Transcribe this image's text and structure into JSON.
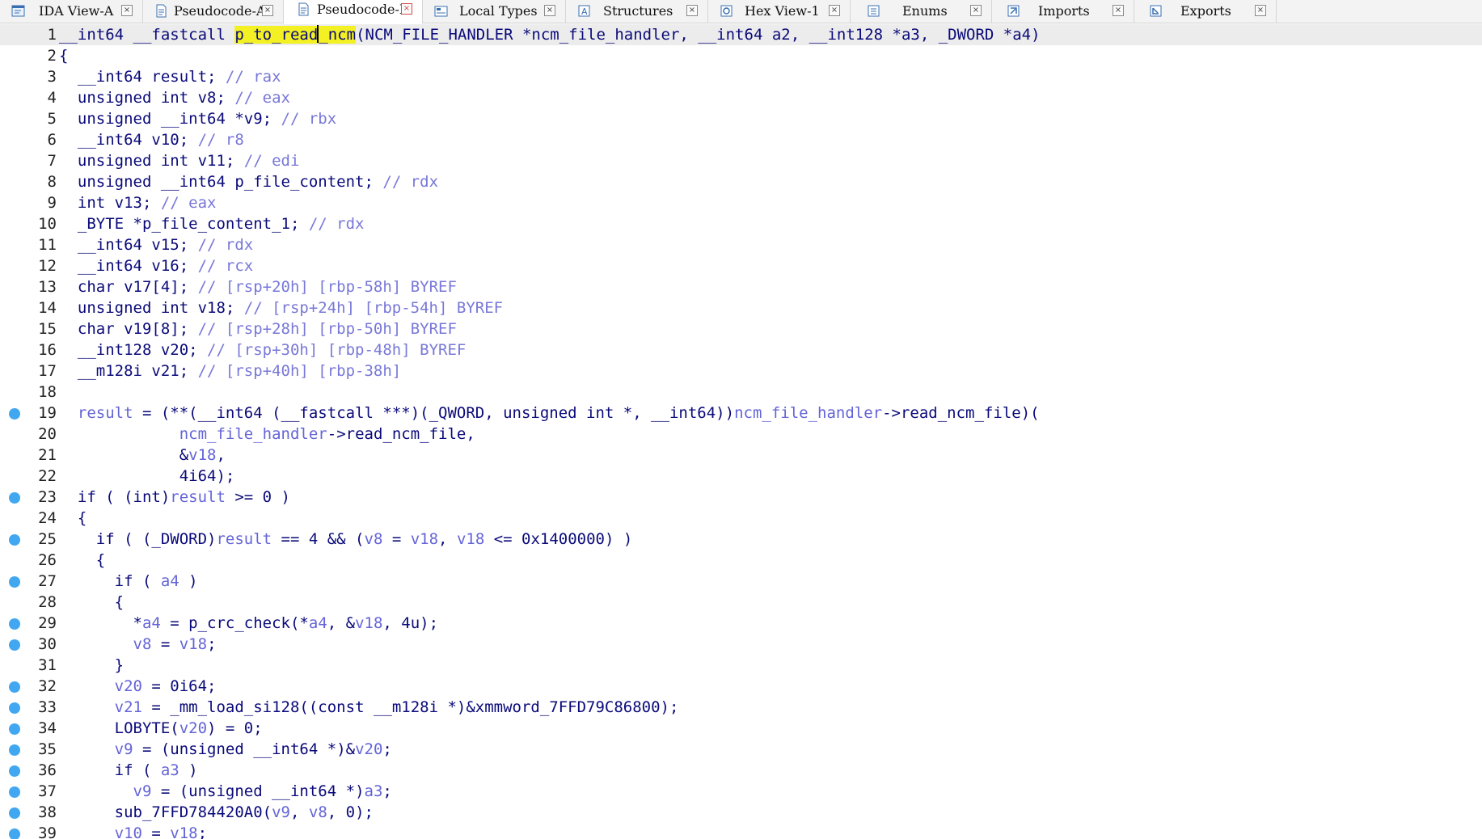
{
  "colors": {
    "keyword": "#0a0a7a",
    "variable": "#6464d8",
    "comment": "#7878d8",
    "highlight": "#f3f023",
    "breakpoint_dot": "#41a7f0",
    "current_line_bg": "#ececec"
  },
  "tabs": [
    {
      "label": "IDA View-A",
      "icon": "ida-view-icon",
      "active": false
    },
    {
      "label": "Pseudocode-A",
      "icon": "pseudocode-icon",
      "active": false
    },
    {
      "label": "Pseudocode-B",
      "icon": "pseudocode-icon",
      "active": true
    },
    {
      "label": "Local Types",
      "icon": "local-types-icon",
      "active": false
    },
    {
      "label": "Structures",
      "icon": "structures-icon",
      "active": false
    },
    {
      "label": "Hex View-1",
      "icon": "hex-view-icon",
      "active": false
    },
    {
      "label": "Enums",
      "icon": "enums-icon",
      "active": false
    },
    {
      "label": "Imports",
      "icon": "imports-icon",
      "active": false
    },
    {
      "label": "Exports",
      "icon": "exports-icon",
      "active": false
    }
  ],
  "close_glyph": "×",
  "code": {
    "highlighted_identifier": "p_to_read_ncm",
    "lines": [
      {
        "n": "1",
        "dot": false,
        "tokens": [
          [
            "k",
            "__int64 __fastcall "
          ],
          [
            "h",
            "p_to_read"
          ],
          [
            "caret",
            ""
          ],
          [
            "h",
            "_ncm"
          ],
          [
            "k",
            "(NCM_FILE_HANDLER *ncm_file_handler, __int64 a2, __int128 *a3, _DWORD *a4)"
          ]
        ]
      },
      {
        "n": "2",
        "dot": false,
        "tokens": [
          [
            "k",
            "{"
          ]
        ]
      },
      {
        "n": "3",
        "dot": false,
        "tokens": [
          [
            "k",
            "  __int64 result; "
          ],
          [
            "c",
            "// rax"
          ]
        ]
      },
      {
        "n": "4",
        "dot": false,
        "tokens": [
          [
            "k",
            "  unsigned int v8; "
          ],
          [
            "c",
            "// eax"
          ]
        ]
      },
      {
        "n": "5",
        "dot": false,
        "tokens": [
          [
            "k",
            "  unsigned __int64 *v9; "
          ],
          [
            "c",
            "// rbx"
          ]
        ]
      },
      {
        "n": "6",
        "dot": false,
        "tokens": [
          [
            "k",
            "  __int64 v10; "
          ],
          [
            "c",
            "// r8"
          ]
        ]
      },
      {
        "n": "7",
        "dot": false,
        "tokens": [
          [
            "k",
            "  unsigned int v11; "
          ],
          [
            "c",
            "// edi"
          ]
        ]
      },
      {
        "n": "8",
        "dot": false,
        "tokens": [
          [
            "k",
            "  unsigned __int64 p_file_content; "
          ],
          [
            "c",
            "// rdx"
          ]
        ]
      },
      {
        "n": "9",
        "dot": false,
        "tokens": [
          [
            "k",
            "  int v13; "
          ],
          [
            "c",
            "// eax"
          ]
        ]
      },
      {
        "n": "10",
        "dot": false,
        "tokens": [
          [
            "k",
            "  _BYTE *p_file_content_1; "
          ],
          [
            "c",
            "// rdx"
          ]
        ]
      },
      {
        "n": "11",
        "dot": false,
        "tokens": [
          [
            "k",
            "  __int64 v15; "
          ],
          [
            "c",
            "// rdx"
          ]
        ]
      },
      {
        "n": "12",
        "dot": false,
        "tokens": [
          [
            "k",
            "  __int64 v16; "
          ],
          [
            "c",
            "// rcx"
          ]
        ]
      },
      {
        "n": "13",
        "dot": false,
        "tokens": [
          [
            "k",
            "  char v17[4]; "
          ],
          [
            "c",
            "// [rsp+20h] [rbp-58h] BYREF"
          ]
        ]
      },
      {
        "n": "14",
        "dot": false,
        "tokens": [
          [
            "k",
            "  unsigned int v18; "
          ],
          [
            "c",
            "// [rsp+24h] [rbp-54h] BYREF"
          ]
        ]
      },
      {
        "n": "15",
        "dot": false,
        "tokens": [
          [
            "k",
            "  char v19[8]; "
          ],
          [
            "c",
            "// [rsp+28h] [rbp-50h] BYREF"
          ]
        ]
      },
      {
        "n": "16",
        "dot": false,
        "tokens": [
          [
            "k",
            "  __int128 v20; "
          ],
          [
            "c",
            "// [rsp+30h] [rbp-48h] BYREF"
          ]
        ]
      },
      {
        "n": "17",
        "dot": false,
        "tokens": [
          [
            "k",
            "  __m128i v21; "
          ],
          [
            "c",
            "// [rsp+40h] [rbp-38h]"
          ]
        ]
      },
      {
        "n": "18",
        "dot": false,
        "tokens": [
          [
            "k",
            ""
          ]
        ]
      },
      {
        "n": "19",
        "dot": true,
        "tokens": [
          [
            "k",
            "  "
          ],
          [
            "v",
            "result"
          ],
          [
            "k",
            " = (**(__int64 (__fastcall ***)(_QWORD, unsigned int *, __int64))"
          ],
          [
            "v",
            "ncm_file_handler"
          ],
          [
            "k",
            "->read_ncm_file)("
          ]
        ]
      },
      {
        "n": "20",
        "dot": false,
        "tokens": [
          [
            "k",
            "             "
          ],
          [
            "v",
            "ncm_file_handler"
          ],
          [
            "k",
            "->read_ncm_file,"
          ]
        ]
      },
      {
        "n": "21",
        "dot": false,
        "tokens": [
          [
            "k",
            "             &"
          ],
          [
            "v",
            "v18"
          ],
          [
            "k",
            ","
          ]
        ]
      },
      {
        "n": "22",
        "dot": false,
        "tokens": [
          [
            "k",
            "             4i64);"
          ]
        ]
      },
      {
        "n": "23",
        "dot": true,
        "tokens": [
          [
            "k",
            "  if ( (int)"
          ],
          [
            "v",
            "result"
          ],
          [
            "k",
            " >= 0 )"
          ]
        ]
      },
      {
        "n": "24",
        "dot": false,
        "tokens": [
          [
            "k",
            "  {"
          ]
        ]
      },
      {
        "n": "25",
        "dot": true,
        "tokens": [
          [
            "k",
            "    if ( (_DWORD)"
          ],
          [
            "v",
            "result"
          ],
          [
            "k",
            " == 4 && ("
          ],
          [
            "v",
            "v8"
          ],
          [
            "k",
            " = "
          ],
          [
            "v",
            "v18"
          ],
          [
            "k",
            ", "
          ],
          [
            "v",
            "v18"
          ],
          [
            "k",
            " <= 0x1400000) )"
          ]
        ]
      },
      {
        "n": "26",
        "dot": false,
        "tokens": [
          [
            "k",
            "    {"
          ]
        ]
      },
      {
        "n": "27",
        "dot": true,
        "tokens": [
          [
            "k",
            "      if ( "
          ],
          [
            "v",
            "a4"
          ],
          [
            "k",
            " )"
          ]
        ]
      },
      {
        "n": "28",
        "dot": false,
        "tokens": [
          [
            "k",
            "      {"
          ]
        ]
      },
      {
        "n": "29",
        "dot": true,
        "tokens": [
          [
            "k",
            "        *"
          ],
          [
            "v",
            "a4"
          ],
          [
            "k",
            " = p_crc_check(*"
          ],
          [
            "v",
            "a4"
          ],
          [
            "k",
            ", &"
          ],
          [
            "v",
            "v18"
          ],
          [
            "k",
            ", 4u);"
          ]
        ]
      },
      {
        "n": "30",
        "dot": true,
        "tokens": [
          [
            "k",
            "        "
          ],
          [
            "v",
            "v8"
          ],
          [
            "k",
            " = "
          ],
          [
            "v",
            "v18"
          ],
          [
            "k",
            ";"
          ]
        ]
      },
      {
        "n": "31",
        "dot": false,
        "tokens": [
          [
            "k",
            "      }"
          ]
        ]
      },
      {
        "n": "32",
        "dot": true,
        "tokens": [
          [
            "k",
            "      "
          ],
          [
            "v",
            "v20"
          ],
          [
            "k",
            " = 0i64;"
          ]
        ]
      },
      {
        "n": "33",
        "dot": true,
        "tokens": [
          [
            "k",
            "      "
          ],
          [
            "v",
            "v21"
          ],
          [
            "k",
            " = _mm_load_si128((const __m128i *)&xmmword_7FFD79C86800);"
          ]
        ]
      },
      {
        "n": "34",
        "dot": true,
        "tokens": [
          [
            "k",
            "      LOBYTE("
          ],
          [
            "v",
            "v20"
          ],
          [
            "k",
            ") = 0;"
          ]
        ]
      },
      {
        "n": "35",
        "dot": true,
        "tokens": [
          [
            "k",
            "      "
          ],
          [
            "v",
            "v9"
          ],
          [
            "k",
            " = (unsigned __int64 *)&"
          ],
          [
            "v",
            "v20"
          ],
          [
            "k",
            ";"
          ]
        ]
      },
      {
        "n": "36",
        "dot": true,
        "tokens": [
          [
            "k",
            "      if ( "
          ],
          [
            "v",
            "a3"
          ],
          [
            "k",
            " )"
          ]
        ]
      },
      {
        "n": "37",
        "dot": true,
        "tokens": [
          [
            "k",
            "        "
          ],
          [
            "v",
            "v9"
          ],
          [
            "k",
            " = (unsigned __int64 *)"
          ],
          [
            "v",
            "a3"
          ],
          [
            "k",
            ";"
          ]
        ]
      },
      {
        "n": "38",
        "dot": true,
        "tokens": [
          [
            "k",
            "      sub_7FFD784420A0("
          ],
          [
            "v",
            "v9"
          ],
          [
            "k",
            ", "
          ],
          [
            "v",
            "v8"
          ],
          [
            "k",
            ", 0);"
          ]
        ]
      },
      {
        "n": "39",
        "dot": true,
        "tokens": [
          [
            "k",
            "      "
          ],
          [
            "v",
            "v10"
          ],
          [
            "k",
            " = "
          ],
          [
            "v",
            "v18"
          ],
          [
            "k",
            ";"
          ]
        ]
      }
    ]
  }
}
